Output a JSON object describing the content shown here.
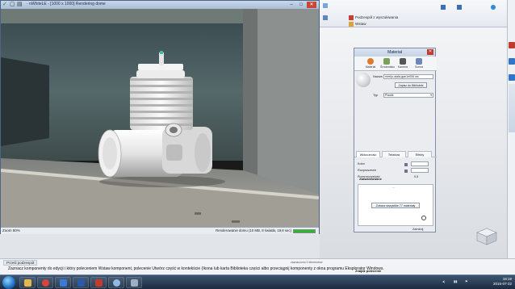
{
  "render_window": {
    "title": "· nWhiteLE - [1000 x 1000] Rendering dome",
    "zoom": "Zoom 60%",
    "status": "Renderowanie domu (10 MB, 8 światła, 19,8 sec)",
    "progress_percent": 100,
    "buttons": {
      "minimize": "–",
      "maximize": "□",
      "close": "✕"
    }
  },
  "ribbon": {
    "podzespol": "Podzespół z wyszukiwania",
    "wstaw": "Wstaw"
  },
  "material_dialog": {
    "title": "Materiał",
    "tabs": [
      "Materiał",
      "Środowisko",
      "Kamera",
      "Scena"
    ],
    "name_label": "Nazwa",
    "name_value": "meri(u-stala-gan1e006 ws",
    "assign_button": "Zapisz do Biblioteki",
    "type_label": "Typ",
    "type_value": "Plastik",
    "subtabs": [
      "Widoczność",
      "Tekstura",
      "Efekty"
    ],
    "rows": [
      "Kolor",
      "Rozproszenie",
      "Przezroczystość",
      "Zaawansowane"
    ],
    "reflect_value": "0,5",
    "more": "...",
    "library_button": "Zobacz wszystkie 77 materiały",
    "close_label": "Zamknij"
  },
  "status_bar": {
    "breadcrumb": "Prześl podzespół",
    "hint": "Zaznacz komponenty do edycji i który poleceniem Wstaw komponent, polecenie Utwórz część w kontekście (Ikona lub karta Biblioteka części albo przeciągnij komponenty z okna programu Eksplorator Windows.",
    "tray_label": "Znajdź polecenie",
    "coords": "zaznaczono 0 elementów"
  },
  "taskbar": {
    "clock_time": "18:19",
    "clock_date": "2016-07-22"
  },
  "colors": {
    "accent": "#c23b2d",
    "titlebar": "#a9bdd7",
    "taskbar": "#1b2b40",
    "progress": "#2db82d"
  }
}
